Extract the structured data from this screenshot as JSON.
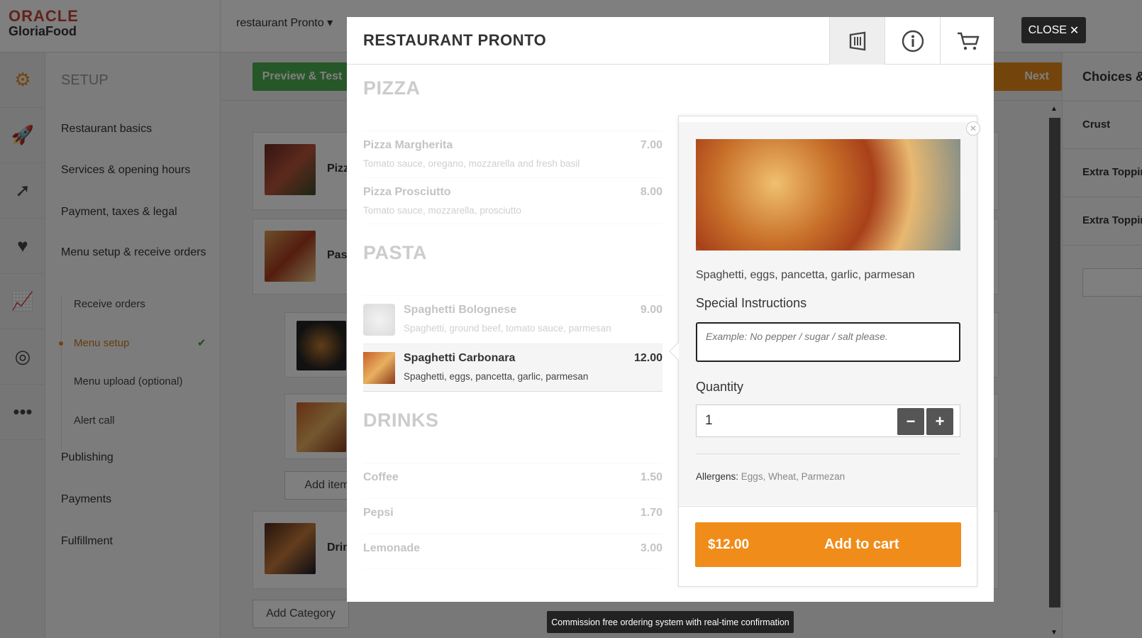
{
  "app": {
    "logo_line1": "ORACLE",
    "logo_line2": "GloriaFood",
    "restaurant_selector": "restaurant Pronto",
    "setup_title": "SETUP",
    "nav": {
      "restaurant_basics": "Restaurant basics",
      "services": "Services & opening hours",
      "payment": "Payment, taxes & legal",
      "menu_setup": "Menu setup & receive orders",
      "sub_receive_orders": "Receive orders",
      "sub_menu_setup": "Menu setup",
      "sub_menu_upload": "Menu upload (optional)",
      "sub_alert_call": "Alert call",
      "publishing": "Publishing",
      "payments": "Payments",
      "fulfillment": "Fulfillment"
    },
    "rail_icons": [
      "gears-icon",
      "rocket-icon",
      "compass-icon",
      "heart-pulse-icon",
      "chart-icon",
      "target-icon",
      "more-icon"
    ],
    "toolbar": {
      "preview": "Preview & Test",
      "next": "Next"
    },
    "categories": [
      {
        "name": "Pizza"
      },
      {
        "name": "Pasta"
      },
      {
        "name": "Drinks"
      }
    ],
    "add_item": "Add item",
    "add_category": "Add Category",
    "right_panel": {
      "title": "Choices & Addons",
      "items": [
        "Crust",
        "Extra Toppings",
        "Extra Toppings"
      ]
    }
  },
  "modal": {
    "title": "RESTAURANT PRONTO",
    "header_icons": [
      "menu-icon",
      "info-icon",
      "cart-icon"
    ],
    "sections": [
      {
        "title": "PIZZA",
        "items": [
          {
            "name": "Pizza Margherita",
            "desc": "Tomato sauce, oregano, mozzarella and fresh basil",
            "price": "7.00"
          },
          {
            "name": "Pizza Prosciutto",
            "desc": "Tomato sauce, mozzarella, prosciutto",
            "price": "8.00"
          }
        ]
      },
      {
        "title": "PASTA",
        "items": [
          {
            "name": "Spaghetti Bolognese",
            "desc": "Spaghetti, ground beef, tomato sauce, parmesan",
            "price": "9.00"
          },
          {
            "name": "Spaghetti Carbonara",
            "desc": "Spaghetti, eggs, pancetta, garlic, parmesan",
            "price": "12.00"
          }
        ]
      },
      {
        "title": "DRINKS",
        "items": [
          {
            "name": "Coffee",
            "price": "1.50"
          },
          {
            "name": "Pepsi",
            "price": "1.70"
          },
          {
            "name": "Lemonade",
            "price": "3.00"
          }
        ]
      }
    ],
    "detail": {
      "description": "Spaghetti, eggs, pancetta, garlic, parmesan",
      "special_instructions_label": "Special Instructions",
      "special_instructions_placeholder": "Example: No pepper / sugar / salt please.",
      "quantity_label": "Quantity",
      "quantity_value": "1",
      "allergens_label": "Allergens",
      "allergens_values": "Eggs, Wheat, Parmezan",
      "price": "$12.00",
      "add_to_cart": "Add to cart"
    }
  },
  "close_label": "CLOSE",
  "tooltip": "Commission free ordering system with real-time confirmation",
  "colors": {
    "accent_orange": "#f08c1a",
    "green": "#4caf50",
    "oracle_red": "#c74634"
  }
}
